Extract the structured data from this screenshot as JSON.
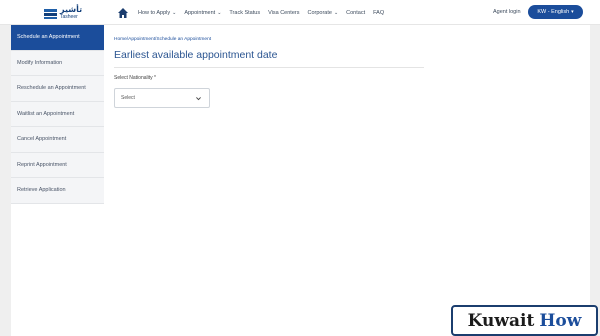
{
  "header": {
    "logo": {
      "arabic": "تأشير",
      "english": "Tasheer"
    },
    "nav": [
      {
        "label": "How to Apply",
        "has_caret": true
      },
      {
        "label": "Appointment",
        "has_caret": true
      },
      {
        "label": "Track Status",
        "has_caret": false
      },
      {
        "label": "Visa Centers",
        "has_caret": false
      },
      {
        "label": "Corporate",
        "has_caret": true
      },
      {
        "label": "Contact",
        "has_caret": false
      },
      {
        "label": "FAQ",
        "has_caret": false
      }
    ],
    "agent_login": "Agent login",
    "language": "KW - English"
  },
  "sidebar": {
    "items": [
      {
        "label": "Schedule an Appointment",
        "active": true
      },
      {
        "label": "Modify Information",
        "active": false
      },
      {
        "label": "Reschedule an Appointment",
        "active": false
      },
      {
        "label": "Waitlist an Appointment",
        "active": false
      },
      {
        "label": "Cancel Appointment",
        "active": false
      },
      {
        "label": "Reprint Appointment",
        "active": false
      },
      {
        "label": "Retrieve Application",
        "active": false
      }
    ]
  },
  "main": {
    "breadcrumb": "Home/Appointment/Schedule an Appointment",
    "title": "Earliest available appointment date",
    "nationality_label": "Select Nationality *",
    "nationality_value": "Select"
  },
  "watermark": {
    "part1": "Kuwait",
    "part2": "How"
  },
  "colors": {
    "primary": "#1b4d9b",
    "title": "#2b5591",
    "sidebar_bg": "#f4f5f7"
  },
  "icons": {
    "home": "home-icon",
    "dropdown": "chevron-down-icon"
  }
}
